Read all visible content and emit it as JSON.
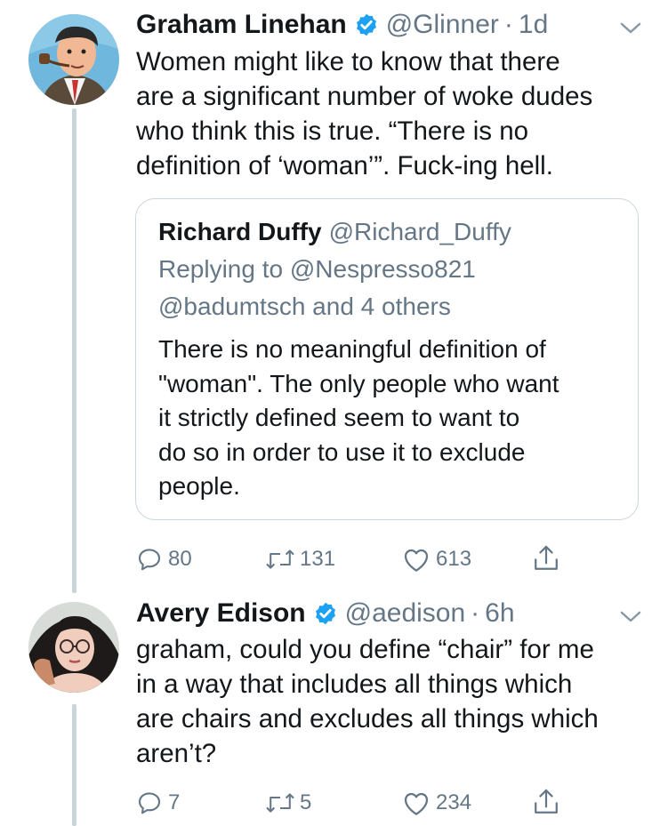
{
  "tweets": [
    {
      "display_name": "Graham Linehan",
      "handle": "@Glinner",
      "separator": "·",
      "age": "1d",
      "text": "Women might like to know that there\nare a significant number of woke dudes\nwho think this is true. “There is no\ndefinition of ‘woman’”. Fuck-ing hell.",
      "quoted": {
        "display_name": "Richard Duffy",
        "handle": "@Richard_Duffy",
        "replying_line1": "Replying to @Nespresso821",
        "replying_line2": "@badumtsch and 4 others",
        "text": "There is no meaningful definition of\n\"woman\". The only people who want\nit strictly defined seem to want to\ndo so in order to use it to exclude\npeople."
      },
      "stats": {
        "replies": "80",
        "retweets": "131",
        "likes": "613"
      }
    },
    {
      "display_name": "Avery Edison",
      "handle": "@aedison",
      "separator": "·",
      "age": "6h",
      "text": "graham, could you define “chair” for me\nin a way that includes all things which\nare chairs and excludes all things which\naren’t?",
      "stats": {
        "replies": "7",
        "retweets": "5",
        "likes": "234"
      }
    }
  ],
  "colors": {
    "text": "#14171a",
    "secondary": "#657786",
    "verified": "#1da1f2",
    "thread_line": "#c9d4db",
    "card_border": "#ccd6dd"
  },
  "icons": [
    "verified-badge-icon",
    "chevron-down-icon",
    "reply-icon",
    "retweet-icon",
    "like-icon",
    "share-icon"
  ]
}
